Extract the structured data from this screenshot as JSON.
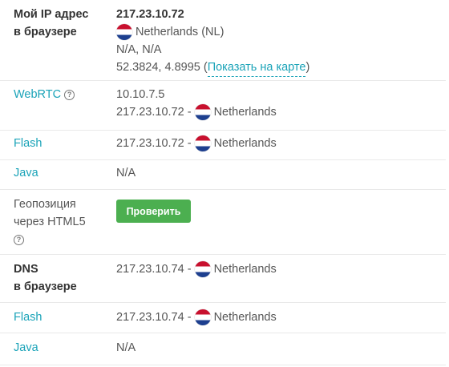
{
  "browser_ip": {
    "label_line1": "Мой IP адрес",
    "label_line2": "в браузере",
    "ip": "217.23.10.72",
    "country": "Netherlands (NL)",
    "region": "N/A, N/A",
    "coords": "52.3824, 4.8995",
    "map_link": "Показать на карте"
  },
  "webrtc": {
    "label": "WebRTC",
    "local_ip": "10.10.7.5",
    "public_ip": "217.23.10.72 - ",
    "country": "Netherlands"
  },
  "flash": {
    "label": "Flash",
    "ip": "217.23.10.72 - ",
    "country": "Netherlands"
  },
  "java": {
    "label": "Java",
    "value": "N/A"
  },
  "geo": {
    "label_line1": "Геопозиция",
    "label_line2": "через HTML5",
    "button": "Проверить"
  },
  "dns": {
    "label_line1": "DNS",
    "label_line2": "в браузере",
    "ip": "217.23.10.74 - ",
    "country": "Netherlands"
  },
  "dns_flash": {
    "label": "Flash",
    "ip": "217.23.10.74 - ",
    "country": "Netherlands"
  },
  "dns_java": {
    "label": "Java",
    "value": "N/A"
  },
  "icons": {
    "flag": "netherlands-flag-icon",
    "help": "question-circle-icon",
    "help_glyph": "?"
  },
  "colors": {
    "link": "#1aa3b8",
    "button": "#4caf50"
  }
}
